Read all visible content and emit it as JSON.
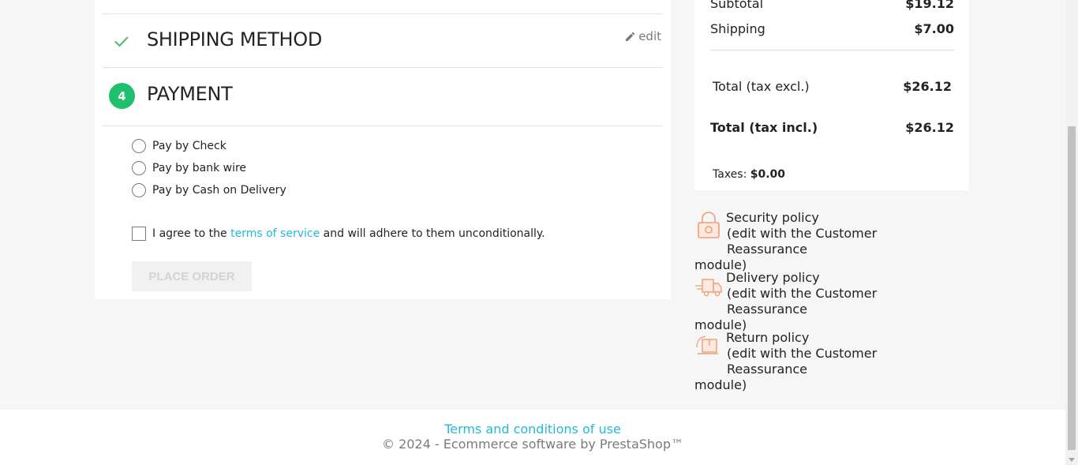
{
  "checkout": {
    "shipping_title": "Shipping Method",
    "edit_label": "edit",
    "payment_step_number": "4",
    "payment_title": "Payment",
    "payment_options": [
      {
        "label": "Pay by Check"
      },
      {
        "label": "Pay by bank wire"
      },
      {
        "label": "Pay by Cash on Delivery"
      }
    ],
    "agree_prefix": "I agree to the ",
    "agree_link": "terms of service",
    "agree_suffix": " and will adhere to them unconditionally.",
    "place_order_label": "Place order"
  },
  "summary": {
    "subtotal_label": "Subtotal",
    "subtotal_value": "$19.12",
    "shipping_label": "Shipping",
    "shipping_value": "$7.00",
    "total_excl_label": "Total (tax excl.)",
    "total_excl_value": "$26.12",
    "total_incl_label": "Total (tax incl.)",
    "total_incl_value": "$26.12",
    "taxes_label": "Taxes: ",
    "taxes_value": "$0.00"
  },
  "reassurance": [
    {
      "title": "Security policy",
      "line1": "(edit with the Customer Reassurance",
      "line2": "module)",
      "icon": "lock-icon"
    },
    {
      "title": "Delivery policy",
      "line1": "(edit with the Customer Reassurance",
      "line2": "module)",
      "icon": "truck-icon"
    },
    {
      "title": "Return policy",
      "line1": "(edit with the Customer Reassurance",
      "line2": "module)",
      "icon": "return-box-icon"
    }
  ],
  "footer": {
    "terms_link": "Terms and conditions of use",
    "copyright": "© 2024 - Ecommerce software by PrestaShop™"
  },
  "colors": {
    "accent": "#24b9d7",
    "step_complete": "#4cbb6c",
    "step_active": "#1fbf6b",
    "reassurance_icon": "#f19d76"
  }
}
